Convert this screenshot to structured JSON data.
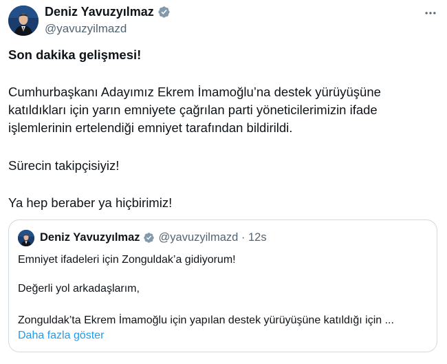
{
  "tweet": {
    "author": {
      "name": "Deniz Yavuzyılmaz",
      "handle": "@yavuzyilmazd"
    },
    "headline": "Son dakika gelişmesi!",
    "body_lines": [
      "Cumhurbaşkanı Adayımız Ekrem İmamoğlu’na destek yürüyüşüne",
      "katıldıkları için yarın emniyete çağrılan parti yöneticilerimizin ifade",
      "işlemlerinin ertelendiği emniyet tarafından bildirildi."
    ],
    "line2": "Sürecin takipçisiyiz!",
    "line3": "Ya hep beraber ya hiçbirimiz!"
  },
  "quote": {
    "author_name": "Deniz Yavuzyılmaz",
    "meta": "@yavuzyilmazd · 12s",
    "line1": "Emniyet ifadeleri için Zonguldak’a gidiyorum!",
    "line2": "Değerli yol arkadaşlarım,",
    "line3": "Zonguldak’ta Ekrem İmamoğlu için yapılan destek yürüyüşüne katıldığı için ...",
    "show_more": "Daha fazla göster"
  },
  "colors": {
    "accent": "#1d9bf0",
    "secondary_text": "#536471",
    "border": "#cfd9de"
  },
  "icons": [
    "verified-badge-icon",
    "more-options-icon"
  ]
}
